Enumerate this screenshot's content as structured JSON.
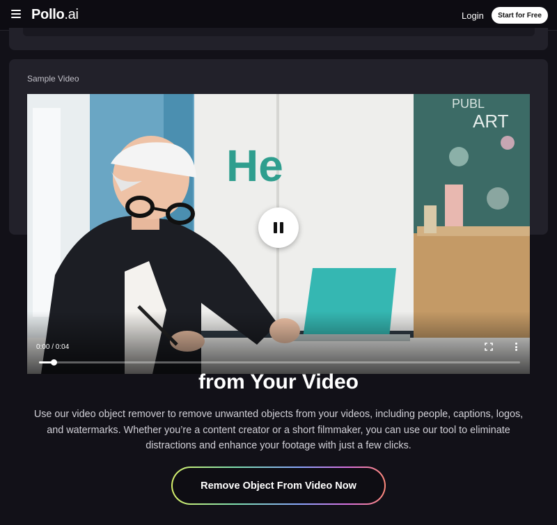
{
  "header": {
    "logo_main": "Pollo",
    "logo_suffix": ".ai",
    "login_label": "Login",
    "start_label": "Start for Free"
  },
  "sample": {
    "label": "Sample Video"
  },
  "video": {
    "time": "0:00 / 0:04",
    "progress_fraction": 0.03,
    "scene_text": "He",
    "board_text_1": "PUBL",
    "board_text_2": "ART",
    "play_state": "playing"
  },
  "content": {
    "headline": "from Your Video",
    "description": "Use our video object remover to remove unwanted objects from your videos, including people, captions, logos, and watermarks. Whether you’re a content creator or a short filmmaker, you can use our tool to eliminate distractions and enhance your footage with just a few clicks.",
    "cta_label": "Remove Object From Video Now"
  },
  "icons": {
    "menu": "menu-icon",
    "pause": "pause-icon",
    "fullscreen": "fullscreen-icon",
    "more": "more-vertical-icon"
  },
  "colors": {
    "page_bg": "#121118",
    "card_bg": "#22212a",
    "accent_gradient": [
      "#d8f06a",
      "#7fe0b0",
      "#8aa6ff",
      "#d870e0",
      "#ff8a7a"
    ]
  }
}
